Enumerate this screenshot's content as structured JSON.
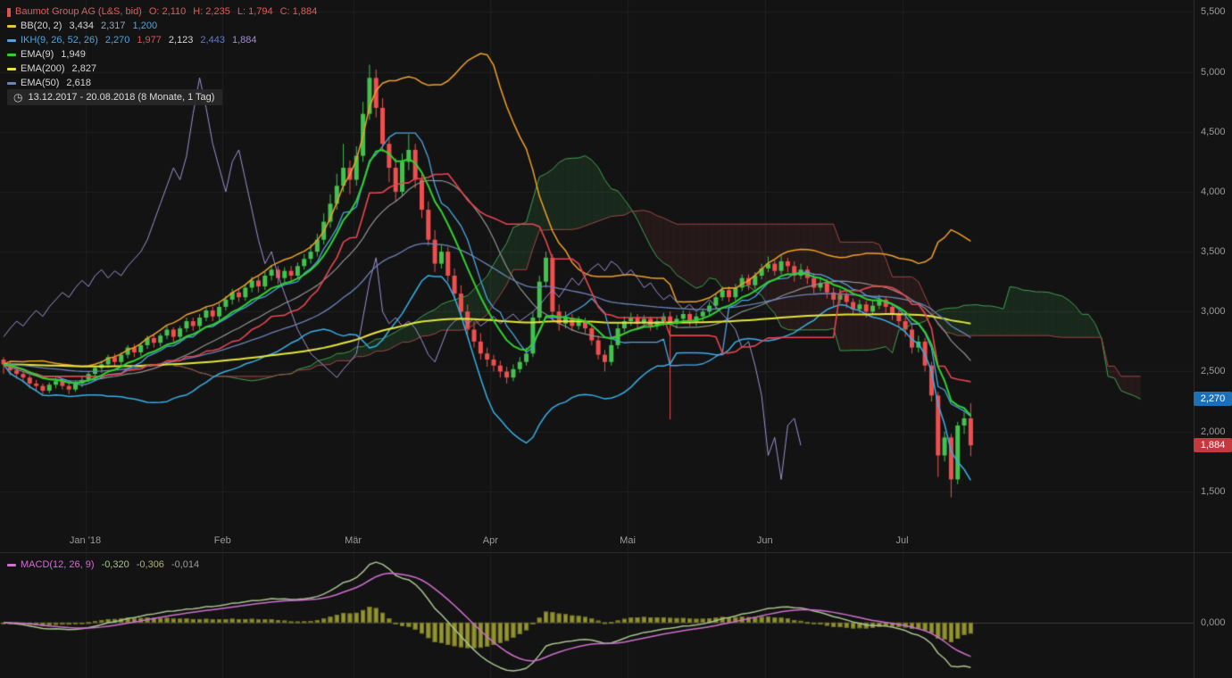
{
  "legend": {
    "rows": [
      {
        "id": "symbol",
        "swatch": "#e05252",
        "swatch_type": "candle",
        "label": "Baumot Group AG (L&S, bid)",
        "label_color": "#e05c5c",
        "values": [
          {
            "t": "O: 2,110",
            "c": "#e05c5c"
          },
          {
            "t": "H: 2,235",
            "c": "#e05c5c"
          },
          {
            "t": "L: 1,794",
            "c": "#e05c5c"
          },
          {
            "t": "C: 1,884",
            "c": "#e05c5c"
          }
        ]
      },
      {
        "id": "bb",
        "swatch": "#e8c832",
        "swatch_type": "line",
        "label": "BB(20, 2)",
        "label_color": "#d6d6d6",
        "values": [
          {
            "t": "3,434",
            "c": "#d6d6d6"
          },
          {
            "t": "2,317",
            "c": "#9aa4b8"
          },
          {
            "t": "1,200",
            "c": "#4fa3e0"
          }
        ]
      },
      {
        "id": "ikh",
        "swatch": "#4fa3e0",
        "swatch_type": "line",
        "label": "IKH(9, 26, 52, 26)",
        "label_color": "#4fa3e0",
        "values": [
          {
            "t": "2,270",
            "c": "#4fa3e0"
          },
          {
            "t": "1,977",
            "c": "#e05252"
          },
          {
            "t": "2,123",
            "c": "#d6d6d6"
          },
          {
            "t": "2,443",
            "c": "#5f78d0"
          },
          {
            "t": "1,884",
            "c": "#9d8fd0"
          }
        ]
      },
      {
        "id": "ema9",
        "swatch": "#2fd12f",
        "swatch_type": "line",
        "label": "EMA(9)",
        "label_color": "#d6d6d6",
        "values": [
          {
            "t": "1,949",
            "c": "#d6d6d6"
          }
        ]
      },
      {
        "id": "ema200",
        "swatch": "#e6e63c",
        "swatch_type": "line",
        "label": "EMA(200)",
        "label_color": "#d6d6d6",
        "values": [
          {
            "t": "2,827",
            "c": "#d6d6d6"
          }
        ]
      },
      {
        "id": "ema50",
        "swatch": "#6b83b8",
        "swatch_type": "line",
        "label": "EMA(50)",
        "label_color": "#d6d6d6",
        "values": [
          {
            "t": "2,618",
            "c": "#d6d6d6"
          }
        ]
      }
    ]
  },
  "date_range": {
    "text": "13.12.2017 - 20.08.2018  (8 Monate, 1 Tag)"
  },
  "y_axis": {
    "ticks": [
      {
        "label": "5,500",
        "value": 5500
      },
      {
        "label": "5,000",
        "value": 5000
      },
      {
        "label": "4,500",
        "value": 4500
      },
      {
        "label": "4,000",
        "value": 4000
      },
      {
        "label": "3,500",
        "value": 3500
      },
      {
        "label": "3,000",
        "value": 3000
      },
      {
        "label": "2,500",
        "value": 2500
      },
      {
        "label": "2,000",
        "value": 2000
      },
      {
        "label": "1,500",
        "value": 1500
      }
    ]
  },
  "x_axis": {
    "labels": [
      {
        "text": "Jan '18",
        "i": 13
      },
      {
        "text": "Feb",
        "i": 34
      },
      {
        "text": "Mär",
        "i": 54
      },
      {
        "text": "Apr",
        "i": 75
      },
      {
        "text": "Mai",
        "i": 96
      },
      {
        "text": "Jun",
        "i": 117
      },
      {
        "text": "Jul",
        "i": 138
      }
    ]
  },
  "badges": [
    {
      "name": "tenkan-price-badge",
      "label": "2,270",
      "value": 2270,
      "color": "#1d6fb8"
    },
    {
      "name": "last-price-badge",
      "label": "1,884",
      "value": 1884,
      "color": "#c5383d"
    }
  ],
  "macd_panel": {
    "legend": {
      "label": "MACD(12, 26, 9)",
      "label_color": "#cf6fcf",
      "swatch": "#cf6fcf",
      "values": [
        {
          "t": "-0,320",
          "c": "#a9c291"
        },
        {
          "t": "-0,306",
          "c": "#b0b080"
        },
        {
          "t": "-0,014",
          "c": "#9a9a9a"
        }
      ]
    },
    "zero_label": "0,000"
  },
  "chart_data": [
    {
      "type": "candlestick",
      "title": "Baumot Group AG (L&S, bid)",
      "interval": "1 Tag",
      "visible_range": "13.12.2017 - 20.08.2018",
      "last_ohlc_display": {
        "o": "2,110",
        "h": "2,235",
        "l": "1,794",
        "c": "1,884"
      },
      "y_range": [
        1000,
        5600
      ],
      "grid": true,
      "colors": {
        "up": "#45c14f",
        "down": "#ef4f4f",
        "grid": "#1f1f1f",
        "bb_upper": "#f0a028",
        "bb_middle": "#909090",
        "bb_lower": "#35b0e8",
        "tenkan": "#4fa3e0",
        "kijun": "#e84550",
        "senkou_a": "#3f9f4f",
        "senkou_b": "#a04545",
        "cloud_up": "rgba(63,159,79,0.16)",
        "cloud_down": "rgba(160,69,69,0.13)",
        "chikou": "#9d8fd0",
        "ema9": "#2fd12f",
        "ema50": "#6b83b8",
        "ema200": "#e6e63c"
      },
      "indicators": [
        {
          "name": "BB",
          "params": [
            20,
            2
          ],
          "last": {
            "upper": "3,434",
            "middle": "2,317",
            "lower": "1,200"
          }
        },
        {
          "name": "IKH",
          "params": [
            9,
            26,
            52,
            26
          ],
          "last": {
            "tenkan": "2,270",
            "kijun": "1,977",
            "senkou_a": "2,123",
            "senkou_b": "2,443",
            "chikou": "1,884"
          }
        },
        {
          "name": "EMA",
          "params": [
            9
          ],
          "last": "1,949"
        },
        {
          "name": "EMA",
          "params": [
            200
          ],
          "last": "2,827"
        },
        {
          "name": "EMA",
          "params": [
            50
          ],
          "last": "2,618"
        }
      ],
      "candles": [
        [
          2600,
          2620,
          2480,
          2560
        ],
        [
          2560,
          2580,
          2470,
          2510
        ],
        [
          2510,
          2540,
          2440,
          2480
        ],
        [
          2480,
          2500,
          2410,
          2450
        ],
        [
          2450,
          2470,
          2360,
          2400
        ],
        [
          2400,
          2430,
          2340,
          2380
        ],
        [
          2380,
          2400,
          2300,
          2340
        ],
        [
          2340,
          2410,
          2320,
          2390
        ],
        [
          2390,
          2450,
          2360,
          2420
        ],
        [
          2420,
          2440,
          2350,
          2380
        ],
        [
          2380,
          2400,
          2310,
          2350
        ],
        [
          2350,
          2420,
          2330,
          2400
        ],
        [
          2400,
          2460,
          2370,
          2430
        ],
        [
          2430,
          2500,
          2410,
          2480
        ],
        [
          2480,
          2550,
          2450,
          2530
        ],
        [
          2530,
          2590,
          2490,
          2560
        ],
        [
          2560,
          2640,
          2530,
          2620
        ],
        [
          2620,
          2650,
          2540,
          2580
        ],
        [
          2580,
          2660,
          2550,
          2640
        ],
        [
          2640,
          2720,
          2610,
          2700
        ],
        [
          2700,
          2730,
          2620,
          2660
        ],
        [
          2660,
          2740,
          2630,
          2720
        ],
        [
          2720,
          2800,
          2690,
          2780
        ],
        [
          2780,
          2810,
          2700,
          2740
        ],
        [
          2740,
          2820,
          2710,
          2800
        ],
        [
          2800,
          2880,
          2770,
          2850
        ],
        [
          2850,
          2870,
          2750,
          2790
        ],
        [
          2790,
          2880,
          2760,
          2860
        ],
        [
          2860,
          2950,
          2830,
          2920
        ],
        [
          2920,
          2950,
          2840,
          2880
        ],
        [
          2880,
          2980,
          2850,
          2950
        ],
        [
          2950,
          3040,
          2920,
          3010
        ],
        [
          3010,
          3040,
          2920,
          2960
        ],
        [
          2960,
          3070,
          2930,
          3040
        ],
        [
          3040,
          3130,
          3010,
          3100
        ],
        [
          3100,
          3190,
          3060,
          3160
        ],
        [
          3160,
          3190,
          3080,
          3120
        ],
        [
          3120,
          3230,
          3090,
          3200
        ],
        [
          3200,
          3290,
          3160,
          3260
        ],
        [
          3260,
          3300,
          3160,
          3210
        ],
        [
          3210,
          3330,
          3180,
          3300
        ],
        [
          3300,
          3390,
          3260,
          3350
        ],
        [
          3350,
          3380,
          3230,
          3280
        ],
        [
          3280,
          3370,
          3240,
          3340
        ],
        [
          3340,
          3380,
          3250,
          3300
        ],
        [
          3300,
          3410,
          3270,
          3380
        ],
        [
          3380,
          3480,
          3350,
          3440
        ],
        [
          3440,
          3560,
          3400,
          3500
        ],
        [
          3500,
          3650,
          3460,
          3600
        ],
        [
          3600,
          3820,
          3560,
          3750
        ],
        [
          3750,
          3980,
          3700,
          3900
        ],
        [
          3900,
          4150,
          3850,
          4050
        ],
        [
          4050,
          4400,
          4000,
          4200
        ],
        [
          4200,
          4260,
          3980,
          4100
        ],
        [
          4100,
          4380,
          4050,
          4300
        ],
        [
          4300,
          4750,
          4250,
          4650
        ],
        [
          4650,
          5060,
          4600,
          4950
        ],
        [
          4950,
          5020,
          4620,
          4700
        ],
        [
          4700,
          4780,
          4330,
          4400
        ],
        [
          4400,
          4450,
          4080,
          4200
        ],
        [
          4200,
          4280,
          3920,
          4000
        ],
        [
          4000,
          4320,
          3960,
          4250
        ],
        [
          4250,
          4480,
          4180,
          4350
        ],
        [
          4350,
          4400,
          4030,
          4100
        ],
        [
          4100,
          4160,
          3780,
          3850
        ],
        [
          3850,
          3920,
          3550,
          3600
        ],
        [
          3600,
          3680,
          3330,
          3400
        ],
        [
          3400,
          3560,
          3360,
          3500
        ],
        [
          3500,
          3540,
          3250,
          3300
        ],
        [
          3300,
          3360,
          3100,
          3150
        ],
        [
          3150,
          3220,
          2950,
          3000
        ],
        [
          3000,
          3060,
          2800,
          2850
        ],
        [
          2850,
          2920,
          2700,
          2750
        ],
        [
          2750,
          2820,
          2600,
          2650
        ],
        [
          2650,
          2700,
          2540,
          2600
        ],
        [
          2600,
          2640,
          2500,
          2550
        ],
        [
          2550,
          2590,
          2450,
          2500
        ],
        [
          2500,
          2540,
          2400,
          2450
        ],
        [
          2450,
          2560,
          2420,
          2520
        ],
        [
          2520,
          2620,
          2490,
          2580
        ],
        [
          2580,
          2700,
          2550,
          2650
        ],
        [
          2650,
          3000,
          2620,
          2950
        ],
        [
          2950,
          3300,
          2900,
          3250
        ],
        [
          3250,
          3500,
          3200,
          3450
        ],
        [
          3450,
          3480,
          2930,
          3000
        ],
        [
          3000,
          3060,
          2840,
          2900
        ],
        [
          2900,
          3000,
          2860,
          2950
        ],
        [
          2950,
          2980,
          2840,
          2880
        ],
        [
          2880,
          2960,
          2850,
          2920
        ],
        [
          2920,
          2950,
          2820,
          2860
        ],
        [
          2860,
          2900,
          2720,
          2760
        ],
        [
          2760,
          2800,
          2600,
          2640
        ],
        [
          2640,
          2680,
          2500,
          2580
        ],
        [
          2580,
          2760,
          2550,
          2720
        ],
        [
          2720,
          2900,
          2690,
          2860
        ],
        [
          2860,
          2960,
          2830,
          2920
        ],
        [
          2920,
          2990,
          2880,
          2950
        ],
        [
          2950,
          2980,
          2860,
          2900
        ],
        [
          2900,
          2970,
          2870,
          2940
        ],
        [
          2940,
          2960,
          2840,
          2880
        ],
        [
          2880,
          2950,
          2850,
          2920
        ],
        [
          2920,
          2990,
          2880,
          2960
        ],
        [
          2960,
          3000,
          2100,
          2900
        ],
        [
          2900,
          2970,
          2860,
          2940
        ],
        [
          2940,
          3010,
          2900,
          2980
        ],
        [
          2980,
          3000,
          2880,
          2920
        ],
        [
          2920,
          2990,
          2880,
          2960
        ],
        [
          2960,
          3030,
          2920,
          3000
        ],
        [
          3000,
          3080,
          2970,
          3050
        ],
        [
          3050,
          3150,
          3020,
          3120
        ],
        [
          3120,
          3210,
          3090,
          3180
        ],
        [
          3180,
          3210,
          3080,
          3120
        ],
        [
          3120,
          3230,
          3090,
          3200
        ],
        [
          3200,
          3310,
          3170,
          3280
        ],
        [
          3280,
          3310,
          3180,
          3220
        ],
        [
          3220,
          3330,
          3190,
          3300
        ],
        [
          3300,
          3400,
          3270,
          3360
        ],
        [
          3360,
          3460,
          3330,
          3400
        ],
        [
          3400,
          3430,
          3300,
          3340
        ],
        [
          3340,
          3470,
          3310,
          3420
        ],
        [
          3420,
          3450,
          3330,
          3380
        ],
        [
          3380,
          3420,
          3250,
          3300
        ],
        [
          3300,
          3400,
          3270,
          3350
        ],
        [
          3350,
          3380,
          3230,
          3280
        ],
        [
          3280,
          3320,
          3150,
          3200
        ],
        [
          3200,
          3290,
          3170,
          3240
        ],
        [
          3240,
          3270,
          3110,
          3160
        ],
        [
          3160,
          3200,
          3050,
          3100
        ],
        [
          3100,
          3190,
          3070,
          3140
        ],
        [
          3140,
          3170,
          3030,
          3080
        ],
        [
          3080,
          3110,
          2970,
          3020
        ],
        [
          3020,
          3100,
          2990,
          3060
        ],
        [
          3060,
          3090,
          2950,
          3000
        ],
        [
          3000,
          3090,
          2970,
          3050
        ],
        [
          3050,
          3140,
          3020,
          3100
        ],
        [
          3100,
          3130,
          2990,
          3040
        ],
        [
          3040,
          3070,
          2930,
          2980
        ],
        [
          2980,
          3010,
          2870,
          2920
        ],
        [
          2920,
          2950,
          2790,
          2850
        ],
        [
          2850,
          2890,
          2650,
          2700
        ],
        [
          2700,
          2800,
          2660,
          2750
        ],
        [
          2750,
          2780,
          2500,
          2550
        ],
        [
          2550,
          2580,
          2250,
          2300
        ],
        [
          2300,
          2330,
          1620,
          1800
        ],
        [
          1800,
          2000,
          1750,
          1950
        ],
        [
          1950,
          1980,
          1450,
          1600
        ],
        [
          1600,
          2080,
          1560,
          2050
        ],
        [
          2050,
          2160,
          1980,
          2110
        ],
        [
          2110,
          2235,
          1794,
          1884
        ]
      ]
    },
    {
      "type": "macd",
      "params": [
        12,
        26,
        9
      ],
      "last_values_display": [
        "-0,320",
        "-0,306",
        "-0,014"
      ],
      "colors": {
        "macd": "#a9c291",
        "signal": "#cf6fcf",
        "hist_fill": "#97972f",
        "hist_stroke": "#70702a",
        "zero": "#3c3c3c"
      },
      "zero_axis_label": "0,000"
    }
  ]
}
